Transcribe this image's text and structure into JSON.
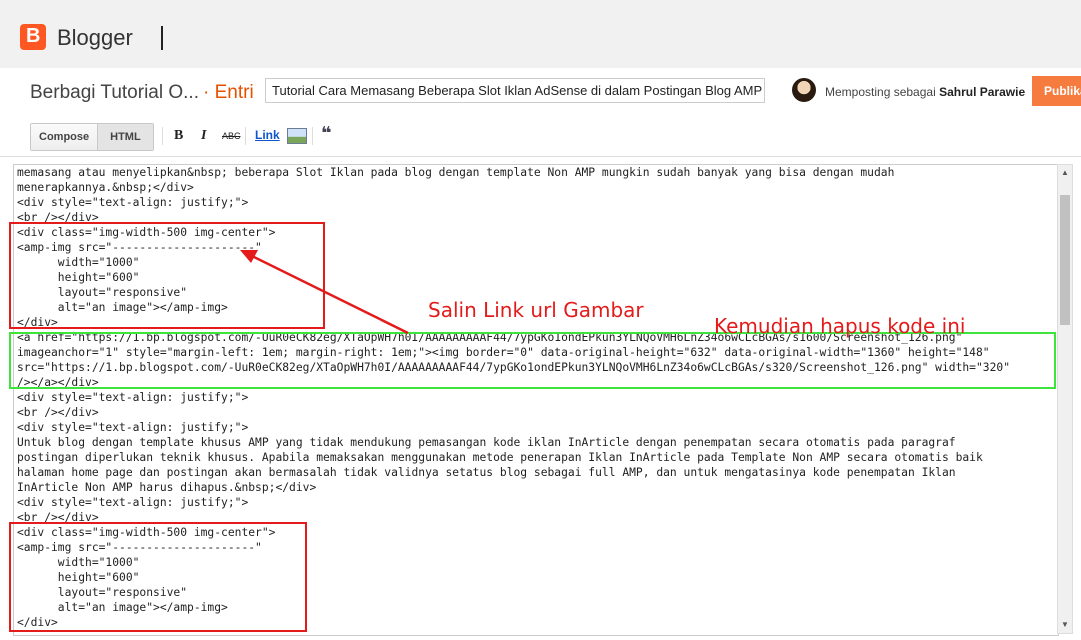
{
  "app": {
    "brand": "Blogger",
    "logo_letter": "B"
  },
  "post": {
    "blog_name": "Berbagi Tutorial O...",
    "crumb": "· Entri",
    "title_value": "Tutorial Cara Memasang Beberapa Slot Iklan AdSense di dalam Postingan Blog AMP",
    "posting_as_label": "Memposting sebagai",
    "author": "Sahrul Parawie",
    "publish_label": "Publika"
  },
  "toolbar": {
    "compose_label": "Compose",
    "html_label": "HTML",
    "bold_icon": "B",
    "italic_icon": "I",
    "strike_icon": "ABC",
    "link_label": "Link",
    "quote_icon": "❝"
  },
  "editor": {
    "code": "memasang atau menyelipkan&nbsp; beberapa Slot Iklan pada blog dengan template Non AMP mungkin sudah banyak yang bisa dengan mudah\nmenerapkannya.&nbsp;</div>\n<div style=\"text-align: justify;\">\n<br /></div>\n<div class=\"img-width-500 img-center\">\n<amp-img src=\"---------------------\"\n      width=\"1000\"\n      height=\"600\"\n      layout=\"responsive\"\n      alt=\"an image\"></amp-img>\n</div>\n<a href=\"https://1.bp.blogspot.com/-UuR0eCK82eg/XTaOpWH7h0I/AAAAAAAAAF44/7ypGKo1ondEPkun3YLNQoVMH6LnZ34o6wCLcBGAs/s1600/Screenshot_126.png\"\nimageanchor=\"1\" style=\"margin-left: 1em; margin-right: 1em;\"><img border=\"0\" data-original-height=\"632\" data-original-width=\"1360\" height=\"148\"\nsrc=\"https://1.bp.blogspot.com/-UuR0eCK82eg/XTaOpWH7h0I/AAAAAAAAAF44/7ypGKo1ondEPkun3YLNQoVMH6LnZ34o6wCLcBGAs/s320/Screenshot_126.png\" width=\"320\"\n/></a></div>\n<div style=\"text-align: justify;\">\n<br /></div>\n<div style=\"text-align: justify;\">\nUntuk blog dengan template khusus AMP yang tidak mendukung pemasangan kode iklan InArticle dengan penempatan secara otomatis pada paragraf\npostingan diperlukan teknik khusus. Apabila memaksakan menggunakan metode penerapan Iklan InArticle pada Template Non AMP secara otomatis baik\nhalaman home page dan postingan akan bermasalah tidak validnya setatus blog sebagai full AMP, dan untuk mengatasinya kode penempatan Iklan\nInArticle Non AMP harus dihapus.&nbsp;</div>\n<div style=\"text-align: justify;\">\n<br /></div>\n<div class=\"img-width-500 img-center\">\n<amp-img src=\"---------------------\"\n      width=\"1000\"\n      height=\"600\"\n      layout=\"responsive\"\n      alt=\"an image\"></amp-img>\n</div>"
  },
  "annotations": {
    "copy_link": "Salin Link url Gambar",
    "delete_code": "Kemudian hapus kode ini"
  },
  "colors": {
    "brand_orange": "#ff5722",
    "annotation_red": "#e31b1b",
    "annotation_green": "#3ce43c"
  }
}
